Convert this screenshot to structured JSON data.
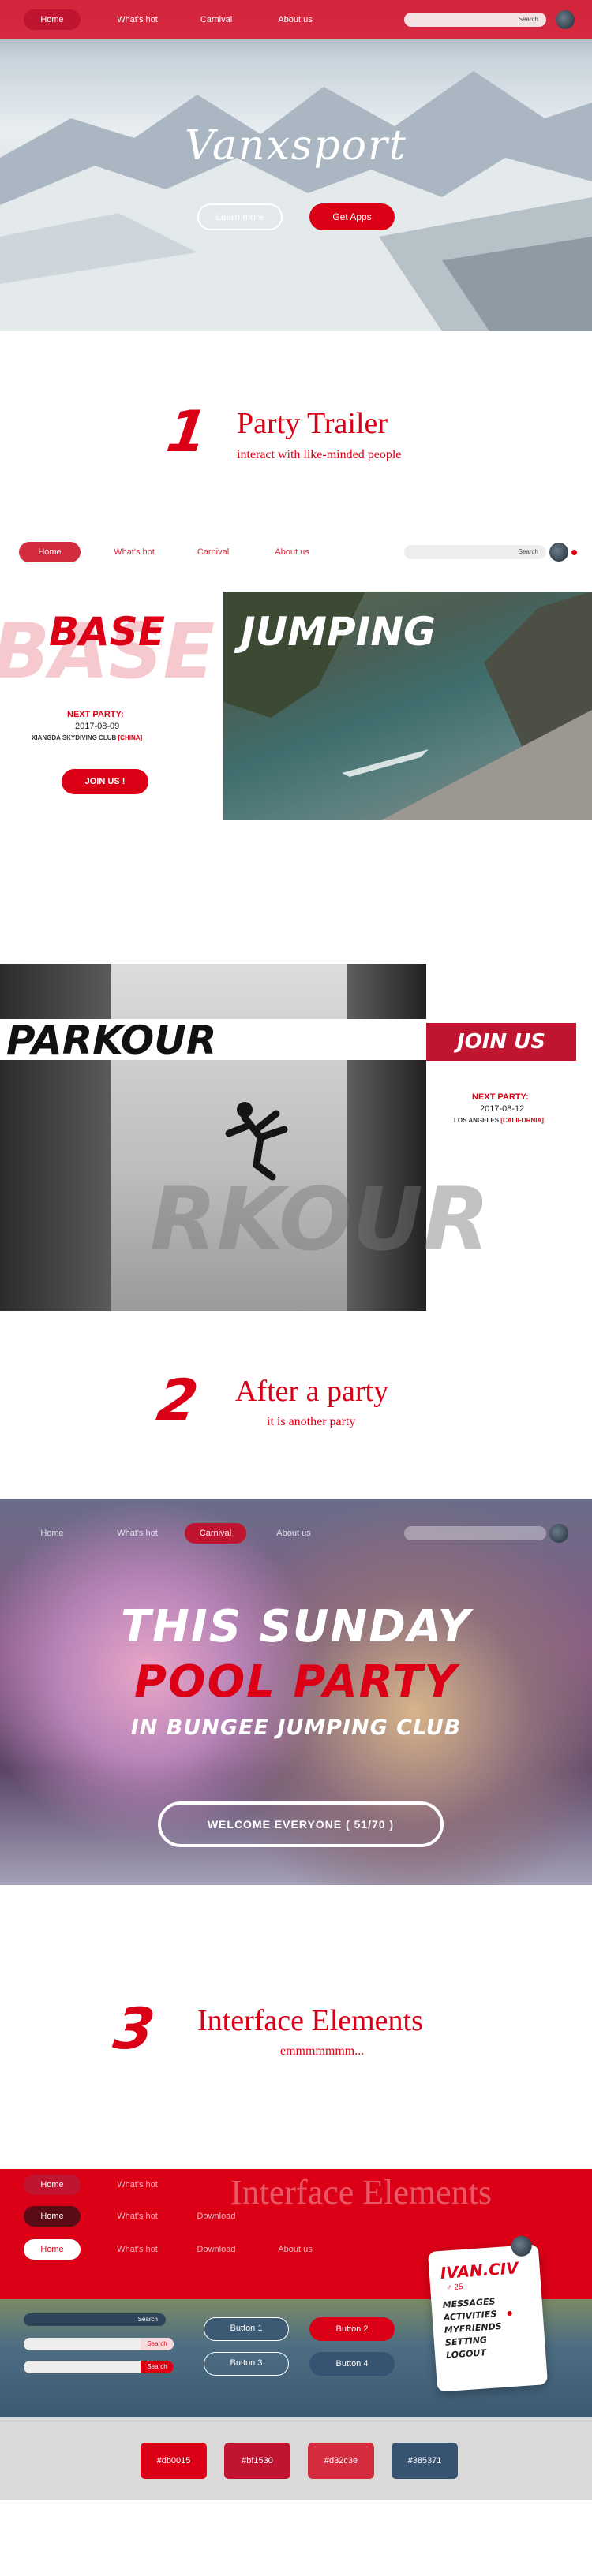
{
  "hero": {
    "nav": [
      "Home",
      "What's hot",
      "Carnival",
      "About us"
    ],
    "search": "Search",
    "brand": "Vanxsport",
    "learn_more": "Learn more",
    "get_apps": "Get Apps"
  },
  "section1": {
    "number": "1",
    "title": "Party Trailer",
    "subtitle": "interact with like-minded people"
  },
  "nav2": {
    "items": [
      "Home",
      "What's hot",
      "Carnival",
      "About us"
    ],
    "search": "Search"
  },
  "base": {
    "title_left": "BASE",
    "title_right": "JUMPING",
    "next_label": "NEXT PARTY:",
    "date": "2017-08-09",
    "club": "XIANGDA SKYDIVING CLUB",
    "place": "[CHINA]",
    "join": "JOIN US !"
  },
  "parkour": {
    "title": "PARKOUR",
    "join": "JOIN US",
    "next_label": "NEXT PARTY:",
    "date": "2017-08-12",
    "club": "LOS ANGELES",
    "place": "[CALIFORNIA]",
    "ghost": "RKOUR"
  },
  "section2": {
    "number": "2",
    "title": "After a party",
    "subtitle": "it is another party"
  },
  "pool": {
    "nav": [
      "Home",
      "What's hot",
      "Carnival",
      "About us"
    ],
    "line1": "THIS SUNDAY",
    "line2": "POOL PARTY",
    "line3": "IN BUNGEE JUMPING CLUB",
    "welcome": "WELCOME EVERYONE ( 51/70 )"
  },
  "section3": {
    "number": "3",
    "title": "Interface Elements",
    "subtitle": "emmmmmmm..."
  },
  "elements": {
    "bg_title": "Interface Elements",
    "nav_a": [
      "Home",
      "What's hot"
    ],
    "nav_b": [
      "Home",
      "What's hot",
      "Download"
    ],
    "nav_c": [
      "Home",
      "What's hot",
      "Download",
      "About us"
    ],
    "search": "Search",
    "buttons": [
      "Button 1",
      "Button 2",
      "Button 3",
      "Button 4"
    ],
    "profile": {
      "name": "IVAN.CIV",
      "age": "25",
      "menu": [
        "MESSAGES",
        "ACTIVITIES",
        "MYFRIENDS",
        "SETTING",
        "LOGOUT"
      ]
    },
    "swatches": [
      "#db0015",
      "#bf1530",
      "#d32c3e",
      "#385371"
    ]
  }
}
